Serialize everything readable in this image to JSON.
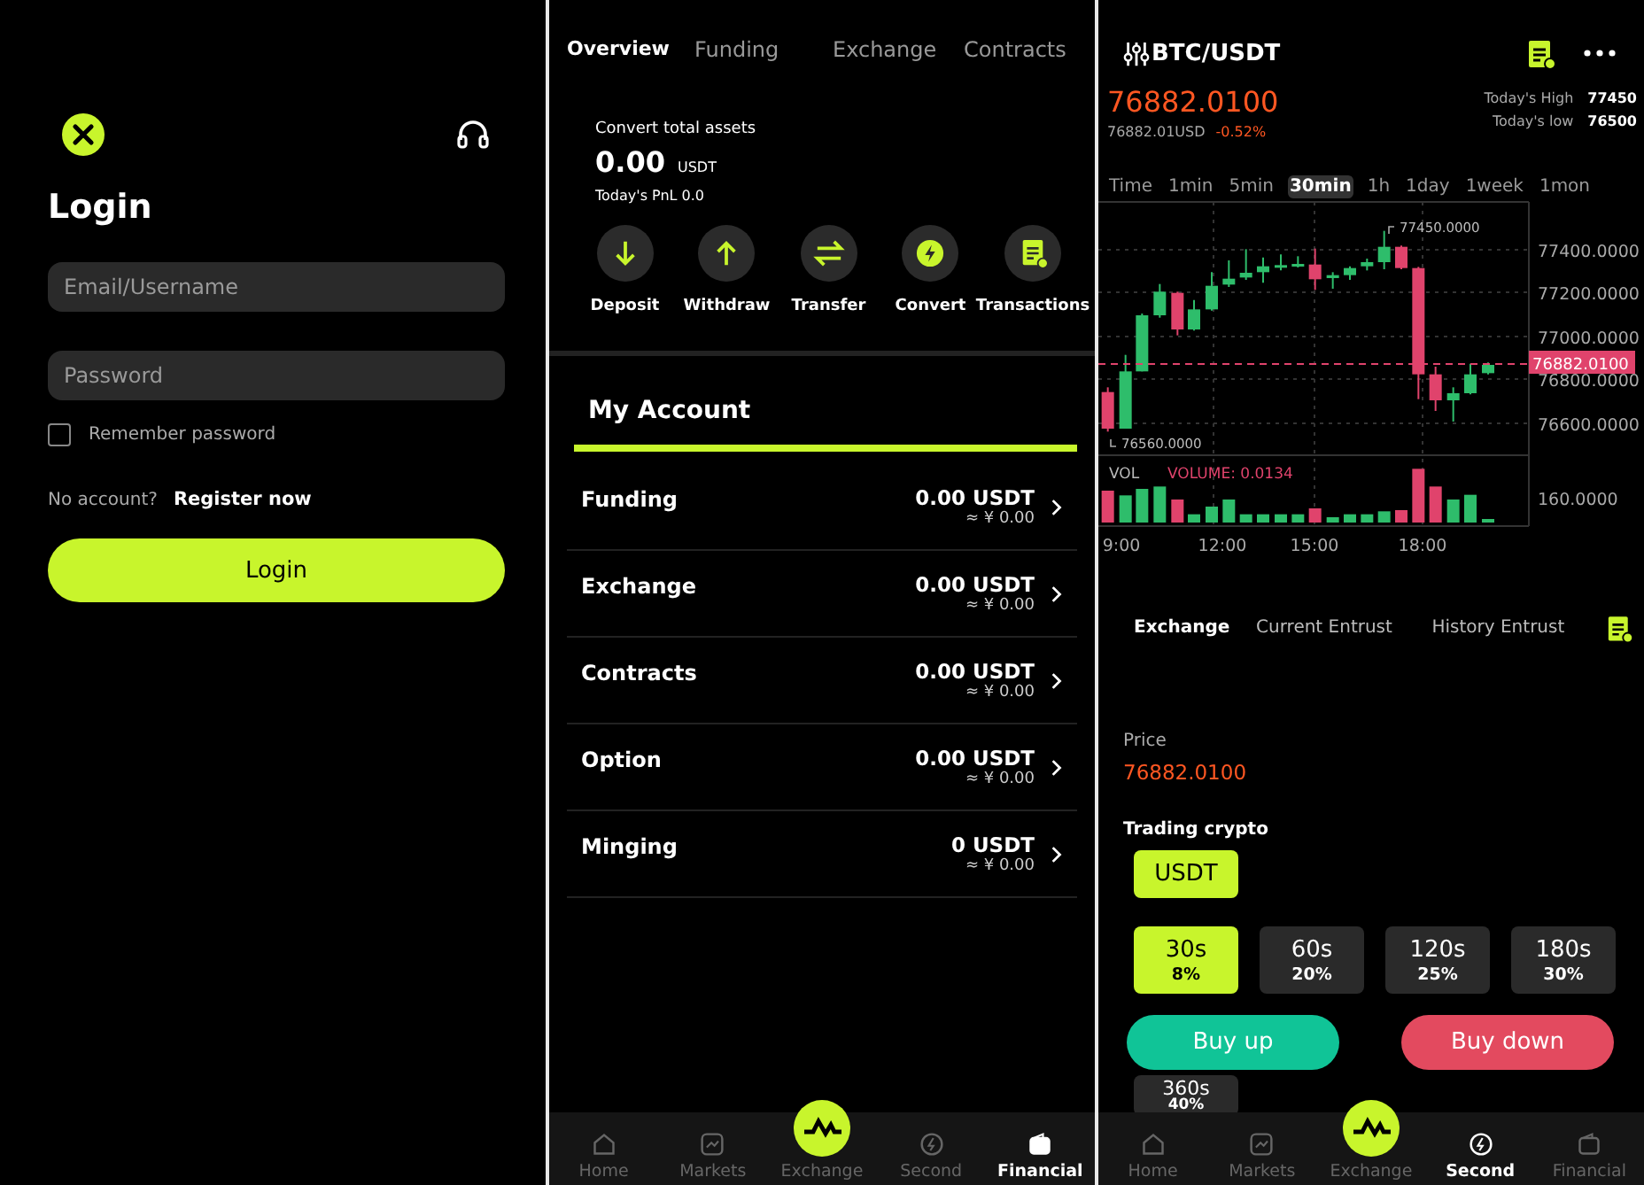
{
  "login_screen": {
    "title": "Login",
    "email_field": {
      "placeholder": "Email/Username"
    },
    "password_field": {
      "placeholder": "Password"
    },
    "remember": {
      "label": "Remember password",
      "checked": false
    },
    "no_account": "No account?",
    "register_link": "Register now",
    "login_button": "Login"
  },
  "assets_screen": {
    "tabs": [
      {
        "label": "Overview",
        "selected": true
      },
      {
        "label": "Funding",
        "selected": false
      },
      {
        "label": "Exchange",
        "selected": false
      },
      {
        "label": "Contracts",
        "selected": false
      }
    ],
    "total_label": "Convert total assets",
    "total_value": "0.00",
    "total_unit": "USDT",
    "pnl": "Today's PnL 0.0",
    "actions": [
      {
        "label": "Deposit",
        "kind": "deposit"
      },
      {
        "label": "Withdraw",
        "kind": "withdraw"
      },
      {
        "label": "Transfer",
        "kind": "transfer"
      },
      {
        "label": "Convert",
        "kind": "convert"
      },
      {
        "label": "Transactions",
        "kind": "transactions"
      }
    ],
    "section_title": "My Account",
    "accounts": [
      {
        "name": "Funding",
        "amount": "0.00 USDT",
        "fiat": "≈ ¥ 0.00"
      },
      {
        "name": "Exchange",
        "amount": "0.00 USDT",
        "fiat": "≈ ¥ 0.00"
      },
      {
        "name": "Contracts",
        "amount": "0.00 USDT",
        "fiat": "≈ ¥ 0.00"
      },
      {
        "name": "Option",
        "amount": "0.00 USDT",
        "fiat": "≈ ¥ 0.00"
      },
      {
        "name": "Minging",
        "amount": "0 USDT",
        "fiat": "≈ ¥ 0.00"
      }
    ],
    "nav": [
      {
        "label": "Home",
        "kind": "home",
        "selected": false
      },
      {
        "label": "Markets",
        "kind": "markets",
        "selected": false
      },
      {
        "label": "Exchange",
        "kind": "exchange",
        "selected": false
      },
      {
        "label": "Second",
        "kind": "second",
        "selected": false
      },
      {
        "label": "Financial",
        "kind": "financial",
        "selected": true
      }
    ]
  },
  "trade_screen": {
    "pair": "BTC/USDT",
    "price": "76882.0100",
    "usd_price": "76882.01USD",
    "change": "-0.52%",
    "high_label": "Today's High",
    "high_value": "77450",
    "low_label": "Today's low",
    "low_value": "76500",
    "intervals": [
      {
        "label": "Time",
        "selected": false
      },
      {
        "label": "1min",
        "selected": false
      },
      {
        "label": "5min",
        "selected": false
      },
      {
        "label": "30min",
        "selected": true
      },
      {
        "label": "1h",
        "selected": false
      },
      {
        "label": "1day",
        "selected": false
      },
      {
        "label": "1week",
        "selected": false
      },
      {
        "label": "1mon",
        "selected": false
      }
    ],
    "chart": {
      "y_labels": [
        "77400.0000",
        "77200.0000",
        "77000.0000",
        "76800.0000",
        "76600.0000"
      ],
      "high_marker": "77450.0000",
      "low_marker": "76560.0000",
      "current_price_tag": "76882.0100",
      "vol_label": "VOL",
      "volume": "VOLUME: 0.0134",
      "vol_label_axis": "160.0000",
      "x_labels": [
        "9:00",
        "12:00",
        "15:00",
        "18:00"
      ]
    },
    "tabs": [
      {
        "label": "Exchange",
        "selected": true
      },
      {
        "label": "Current Entrust",
        "selected": false
      },
      {
        "label": "History Entrust",
        "selected": false
      }
    ],
    "price_label": "Price",
    "price_value": "76882.0100",
    "crypto_label": "Trading crypto",
    "crypto": {
      "label": "USDT",
      "selected": true
    },
    "durations": [
      {
        "time": "30s",
        "rate": "8%",
        "selected": true
      },
      {
        "time": "60s",
        "rate": "20%",
        "selected": false
      },
      {
        "time": "120s",
        "rate": "25%",
        "selected": false
      },
      {
        "time": "180s",
        "rate": "30%",
        "selected": false
      },
      {
        "time": "360s",
        "rate": "40%",
        "selected": false
      }
    ],
    "buy_up": "Buy up",
    "buy_down": "Buy down",
    "nav": [
      {
        "label": "Home",
        "kind": "home",
        "selected": false
      },
      {
        "label": "Markets",
        "kind": "markets",
        "selected": false
      },
      {
        "label": "Exchange",
        "kind": "exchange",
        "selected": false
      },
      {
        "label": "Second",
        "kind": "second",
        "selected": true
      },
      {
        "label": "Financial",
        "kind": "financial",
        "selected": false
      }
    ]
  }
}
